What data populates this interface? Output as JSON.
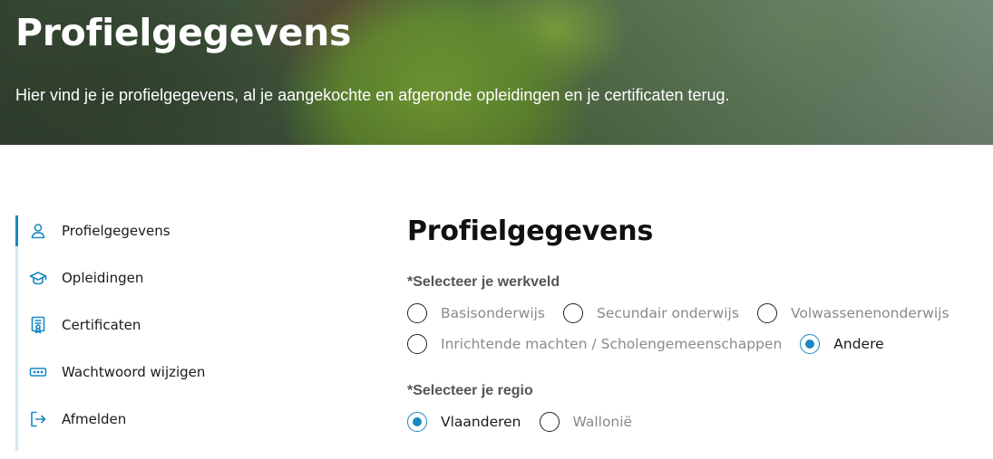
{
  "hero": {
    "title": "Profielgegevens",
    "subtitle": "Hier vind je je profielgegevens, al je aangekochte en afgeronde opleidingen en je certificaten terug."
  },
  "sidebar": {
    "items": [
      {
        "label": "Profielgegevens",
        "icon": "user-icon",
        "active": true
      },
      {
        "label": "Opleidingen",
        "icon": "graduation-cap-icon"
      },
      {
        "label": "Certificaten",
        "icon": "certificate-icon"
      },
      {
        "label": "Wachtwoord wijzigen",
        "icon": "password-icon"
      },
      {
        "label": "Afmelden",
        "icon": "logout-icon"
      }
    ]
  },
  "main": {
    "title": "Profielgegevens",
    "werkveld": {
      "label": "*Selecteer je werkveld",
      "options": [
        "Basisonderwijs",
        "Secundair onderwijs",
        "Volwassenenonderwijs",
        "Inrichtende machten / Scholengemeenschappen",
        "Andere"
      ],
      "selected": "Andere"
    },
    "regio": {
      "label": "*Selecteer je regio",
      "options": [
        "Vlaanderen",
        "Wallonië"
      ],
      "selected": "Vlaanderen"
    }
  },
  "colors": {
    "accent": "#1b88c4",
    "sidebar_border": "#d5e6f0"
  }
}
